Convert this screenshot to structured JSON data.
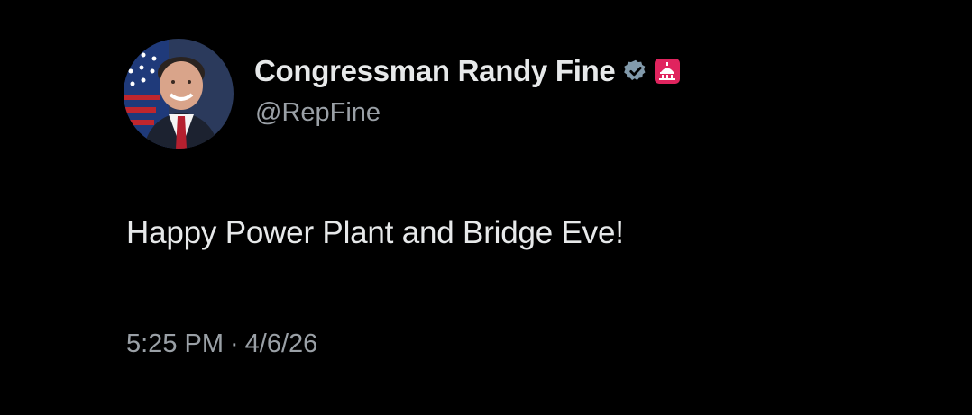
{
  "author": {
    "display_name": "Congressman Randy Fine",
    "handle": "@RepFine",
    "verified_icon": "verified-badge-icon",
    "affiliation_icon": "capitol-affiliation-icon",
    "avatar_icon": "profile-avatar"
  },
  "tweet": {
    "text": "Happy Power Plant and Bridge Eve!"
  },
  "meta": {
    "time": "5:25 PM",
    "separator": "·",
    "date": "4/6/26"
  },
  "colors": {
    "background": "#000000",
    "primary_text": "#e7e9ea",
    "secondary_text": "#9aa0a6",
    "verified_badge": "#829aab",
    "affiliation_badge": "#e0245e"
  }
}
